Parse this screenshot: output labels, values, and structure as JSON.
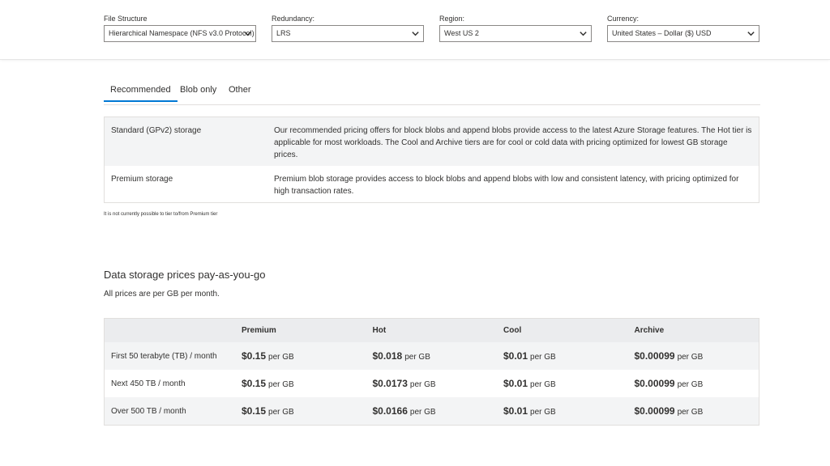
{
  "filters": [
    {
      "label": "File Structure",
      "value": "Hierarchical Namespace (NFS v3.0 Protocol)"
    },
    {
      "label": "Redundancy:",
      "value": "LRS"
    },
    {
      "label": "Region:",
      "value": "West US 2"
    },
    {
      "label": "Currency:",
      "value": "United States – Dollar ($) USD"
    }
  ],
  "tabs": [
    "Recommended",
    "Blob only",
    "Other"
  ],
  "descriptions": [
    {
      "name": "Standard (GPv2) storage",
      "text": "Our recommended pricing offers for block blobs and append blobs provide access to the latest Azure Storage features. The Hot tier is applicable for most workloads. The Cool and Archive tiers are for cool or cold data with pricing optimized for lowest GB storage prices."
    },
    {
      "name": "Premium storage",
      "text": "Premium blob storage provides access to block blobs and append blobs with low and consistent latency, with pricing optimized for high transaction rates."
    }
  ],
  "note": "It is not currently possible to tier to/from Premium tier",
  "section": {
    "title": "Data storage prices pay-as-you-go",
    "subtitle": "All prices are per GB per month."
  },
  "price_table": {
    "headers": [
      "",
      "Premium",
      "Hot",
      "Cool",
      "Archive"
    ],
    "unit": "per GB",
    "rows": [
      {
        "label": "First 50 terabyte (TB) / month",
        "prices": [
          "$0.15",
          "$0.018",
          "$0.01",
          "$0.00099"
        ]
      },
      {
        "label": "Next 450 TB / month",
        "prices": [
          "$0.15",
          "$0.0173",
          "$0.01",
          "$0.00099"
        ]
      },
      {
        "label": "Over 500 TB / month",
        "prices": [
          "$0.15",
          "$0.0166",
          "$0.01",
          "$0.00099"
        ]
      }
    ]
  }
}
